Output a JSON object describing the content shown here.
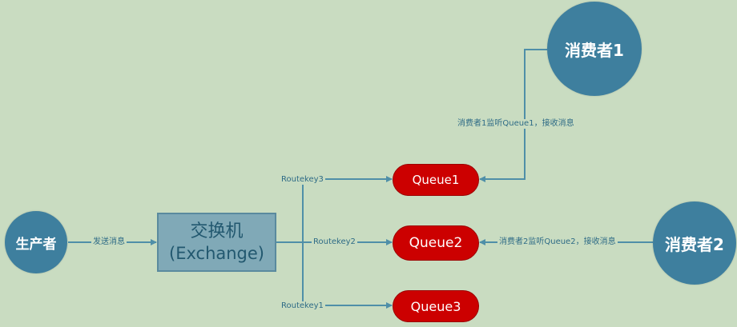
{
  "colors": {
    "background": "#c9dcc1",
    "node_circle": "#3e7f9e",
    "exchange_box": "#80a9b7",
    "queue": "#cc0000",
    "arrow": "#4f8fa8"
  },
  "nodes": {
    "producer": "生产者",
    "exchange_title": "交换机",
    "exchange_subtitle": "(Exchange)",
    "queue1": "Queue1",
    "queue2": "Queue2",
    "queue3": "Queue3",
    "consumer1": "消费者1",
    "consumer2": "消费者2"
  },
  "edges": {
    "send": "发送消息",
    "routekey1": "Routekey1",
    "routekey2": "Routekey2",
    "routekey3": "Routekey3",
    "consumer1_listen": "消费者1监听Queue1，接收消息",
    "consumer2_listen": "消费者2监听Queue2，接收消息"
  }
}
